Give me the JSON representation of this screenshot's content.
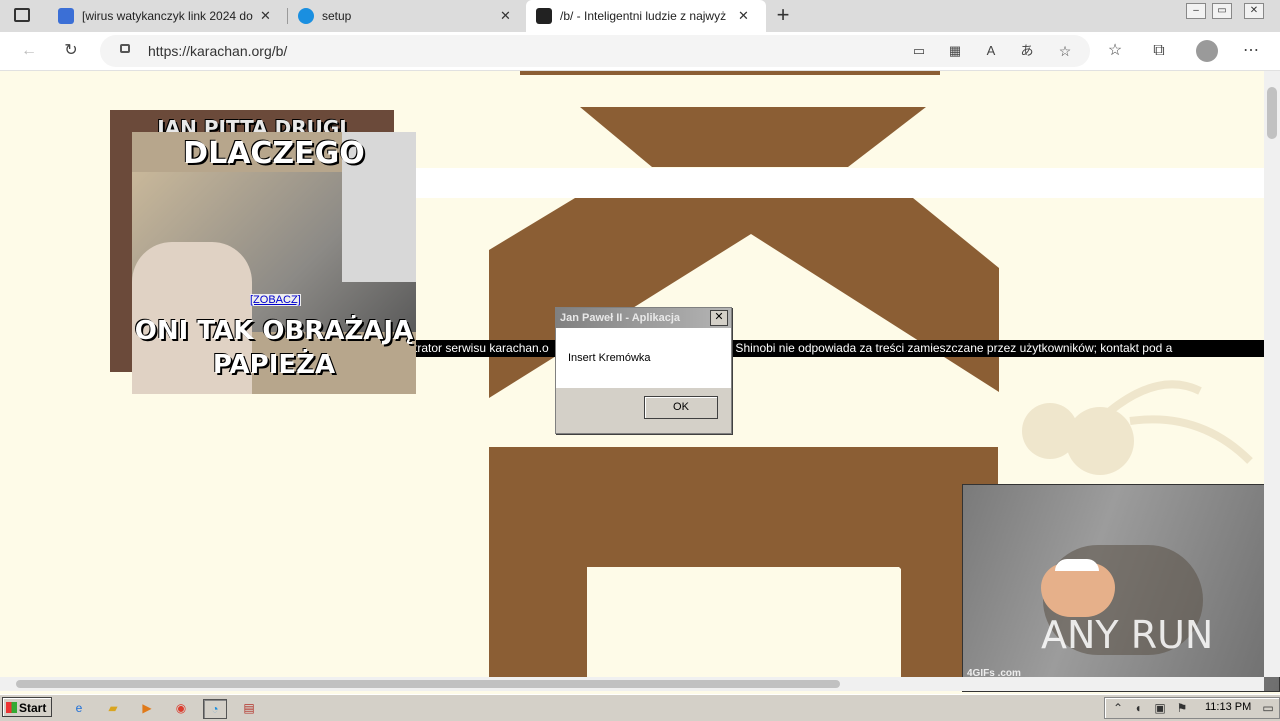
{
  "browser": {
    "tabs": [
      {
        "title": "[wirus watykanczyk link 2024 do"
      },
      {
        "title": "setup"
      },
      {
        "title": "/b/ - Inteligentni ludzie z najwyż"
      }
    ],
    "new_tab_glyph": "+",
    "close_glyph": "✕",
    "url": "https://karachan.org/b/"
  },
  "page": {
    "marquee": "trator serwisu karachan.o                                  ji Smok Ninja Shinobi nie odpowiada za treści zamieszczane przez użytkowników; kontakt pod a",
    "meme_back_top": "JAN PITTA DRUGI",
    "meme_front_top": "DLACZEGO",
    "meme_front_bottom": "ONI TAK OBRAŻAJĄ PAPIEŻA",
    "zobacz_link": "[ZOBACZ]",
    "gif_watermark": "4GIFs .com",
    "anyrun_logo": "ANY RUN"
  },
  "dialog": {
    "title": "Jan Paweł II - Aplikacja",
    "message": "Insert Kremówka",
    "ok_label": "OK"
  },
  "taskbar": {
    "start_label": "Start",
    "clock": "11:13 PM"
  },
  "colors": {
    "brown": "#8b5e34",
    "cream": "#fefbe8"
  }
}
